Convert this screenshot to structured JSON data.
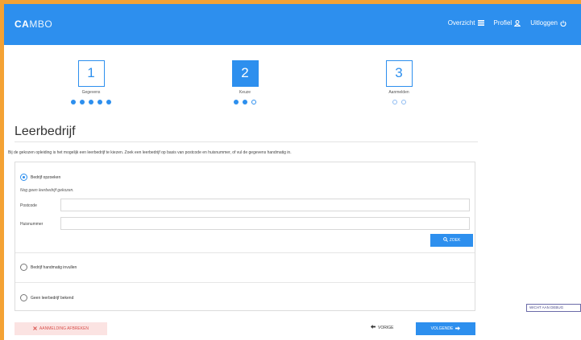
{
  "header": {
    "logo_bold": "CA",
    "logo_rest": "MBO",
    "nav": [
      {
        "label": "Overzicht",
        "icon": "list-icon"
      },
      {
        "label": "Profiel",
        "icon": "user-icon"
      },
      {
        "label": "Uitloggen",
        "icon": "power-icon"
      }
    ]
  },
  "steps": [
    {
      "number": "1",
      "label": "Gegevens",
      "state": "done",
      "dots": 5
    },
    {
      "number": "2",
      "label": "Keuze",
      "state": "active",
      "dots": 3
    },
    {
      "number": "3",
      "label": "Aanmelden",
      "state": "todo",
      "dots": 2
    }
  ],
  "page": {
    "title": "Leerbedrijf",
    "intro": "Bij de gekozen opleiding is het mogelijk een leerbedrijf te kiezen. Zoek een leerbedrijf op basis van postcode en huisnummer, of vul de gegevens handmatig in."
  },
  "form": {
    "option_search": "Bedrijf opzoeken",
    "note": "Nog geen leerbedrijf gekozen.",
    "postcode_label": "Postcode",
    "postcode_value": "",
    "huisnummer_label": "Huisnummer",
    "huisnummer_value": "",
    "search_button": "ZOEK",
    "option_manual": "Bedrijf handmatig invullen",
    "option_none": "Geen leerbedrijf bekend"
  },
  "footer": {
    "cancel": "AANMELDING AFBREKEN",
    "prev": "VORIGE",
    "next": "VOLGENDE"
  },
  "debug": "WICHT AAN DEBUG",
  "colors": {
    "accent": "#2d8fee",
    "frame": "#f4a234",
    "danger": "#d9534f"
  }
}
